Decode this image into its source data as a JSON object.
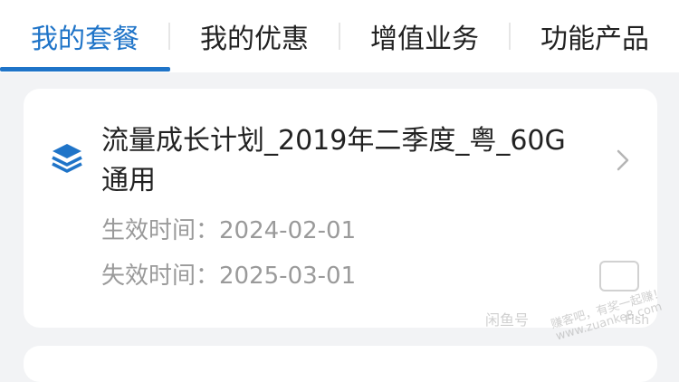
{
  "tabs": [
    {
      "label": "我的套餐",
      "active": true
    },
    {
      "label": "我的优惠",
      "active": false
    },
    {
      "label": "增值业务",
      "active": false
    },
    {
      "label": "功能产品",
      "active": false
    }
  ],
  "accent_color": "#1f74c8",
  "package": {
    "icon": "layers-icon",
    "title": "流量成长计划_2019年二季度_粤_60G通用",
    "effective_label": "生效时间：",
    "effective_date": "2024-02-01",
    "expiry_label": "失效时间：",
    "expiry_date": "2025-03-01"
  },
  "watermark": {
    "site_text": "赚客吧，有奖一起赚！",
    "url": "www.zuanke8.com",
    "brand": "闲鱼号",
    "suffix": "Fish"
  }
}
